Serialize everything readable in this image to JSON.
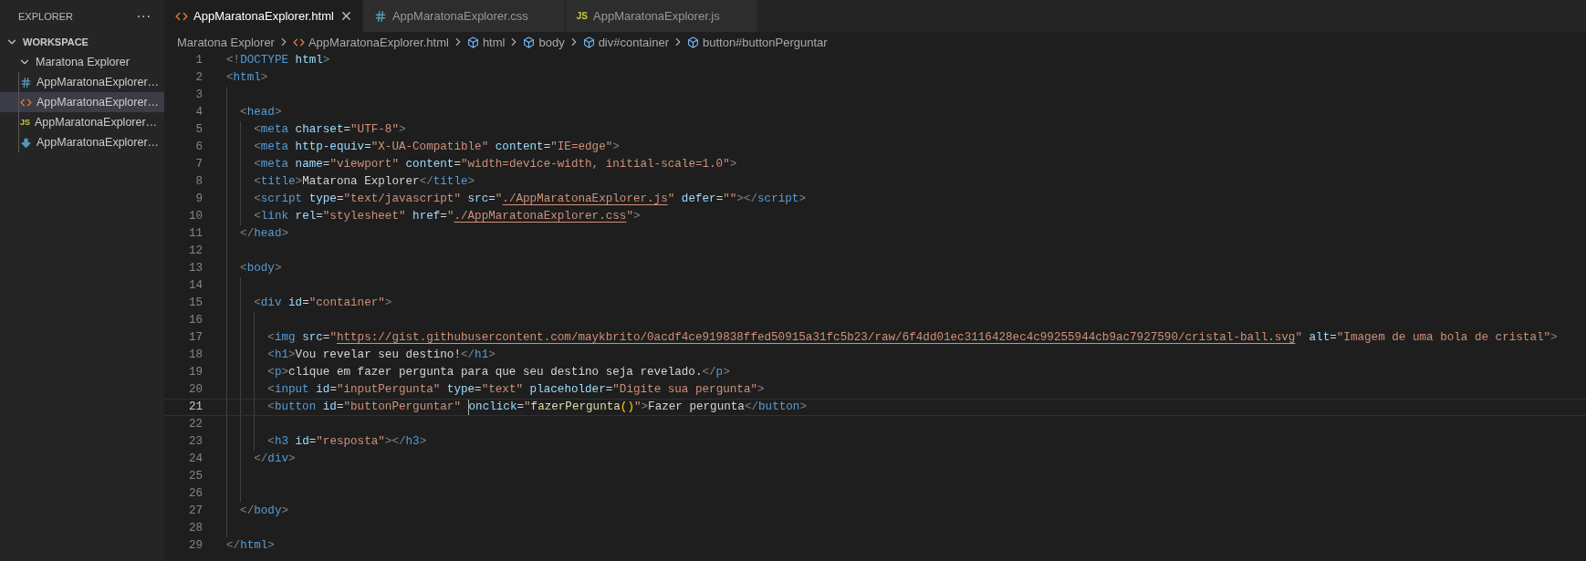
{
  "sidebar": {
    "title": "EXPLORER",
    "more": "···",
    "tree": [
      {
        "label": "WORKSPACE",
        "kind": "root",
        "expanded": true,
        "children": [
          {
            "label": "Maratona Explorer",
            "kind": "folder",
            "expanded": true,
            "children": [
              {
                "label": "AppMaratonaExplorer…",
                "kind": "css",
                "selected": false
              },
              {
                "label": "AppMaratonaExplorer…",
                "kind": "html",
                "selected": true
              },
              {
                "label": "AppMaratonaExplorer…",
                "kind": "js",
                "icon_text": "JS",
                "selected": false
              },
              {
                "label": "AppMaratonaExplorer…",
                "kind": "download",
                "selected": false
              }
            ]
          }
        ]
      }
    ]
  },
  "tabs": [
    {
      "label": "AppMaratonaExplorer.html",
      "kind": "html",
      "selected": true
    },
    {
      "label": "AppMaratonaExplorer.css",
      "kind": "css",
      "selected": false
    },
    {
      "label": "AppMaratonaExplorer.js",
      "kind": "js",
      "icon_text": "JS",
      "selected": false
    }
  ],
  "breadcrumbs": [
    {
      "label": "Maratona Explorer",
      "kind": "folder"
    },
    {
      "label": "AppMaratonaExplorer.html",
      "kind": "html"
    },
    {
      "label": "html",
      "kind": "element"
    },
    {
      "label": "body",
      "kind": "element"
    },
    {
      "label": "div#container",
      "kind": "element"
    },
    {
      "label": "button#buttonPerguntar",
      "kind": "element"
    }
  ],
  "editor": {
    "lines": [
      {
        "number": "1",
        "current": false,
        "tokens": [
          {
            "kind": "punct",
            "text": "<!"
          },
          {
            "kind": "tag",
            "text": "DOCTYPE"
          },
          {
            "kind": "attr",
            "text": " html"
          },
          {
            "kind": "punct",
            "text": ">"
          }
        ]
      },
      {
        "number": "2",
        "current": false,
        "tokens": [
          {
            "kind": "punct",
            "text": "<"
          },
          {
            "kind": "tag",
            "text": "html"
          },
          {
            "kind": "punct",
            "text": ">"
          }
        ]
      },
      {
        "number": "3",
        "current": false
      },
      {
        "number": "4",
        "current": false,
        "tokens": [
          {
            "kind": "punct",
            "text": "  <"
          },
          {
            "kind": "tag",
            "text": "head"
          },
          {
            "kind": "punct",
            "text": ">"
          }
        ]
      },
      {
        "number": "5",
        "current": false,
        "tokens": [
          {
            "kind": "punct",
            "text": "    <"
          },
          {
            "kind": "tag",
            "text": "meta"
          },
          {
            "kind": "attr",
            "text": " charset"
          },
          {
            "kind": "text",
            "text": "="
          },
          {
            "kind": "string",
            "text": "\"UTF-8\""
          },
          {
            "kind": "punct",
            "text": ">"
          }
        ]
      },
      {
        "number": "6",
        "current": false,
        "tokens": [
          {
            "kind": "punct",
            "text": "    <"
          },
          {
            "kind": "tag",
            "text": "meta"
          },
          {
            "kind": "attr",
            "text": " http-equiv"
          },
          {
            "kind": "text",
            "text": "="
          },
          {
            "kind": "string",
            "text": "\"X-UA-Compatible\""
          },
          {
            "kind": "attr",
            "text": " content"
          },
          {
            "kind": "text",
            "text": "="
          },
          {
            "kind": "string",
            "text": "\"IE=edge\""
          },
          {
            "kind": "punct",
            "text": ">"
          }
        ]
      },
      {
        "number": "7",
        "current": false,
        "tokens": [
          {
            "kind": "punct",
            "text": "    <"
          },
          {
            "kind": "tag",
            "text": "meta"
          },
          {
            "kind": "attr",
            "text": " name"
          },
          {
            "kind": "text",
            "text": "="
          },
          {
            "kind": "string",
            "text": "\"viewport\""
          },
          {
            "kind": "attr",
            "text": " content"
          },
          {
            "kind": "text",
            "text": "="
          },
          {
            "kind": "string",
            "text": "\"width=device-width, initial-scale=1.0\""
          },
          {
            "kind": "punct",
            "text": ">"
          }
        ]
      },
      {
        "number": "8",
        "current": false,
        "tokens": [
          {
            "kind": "punct",
            "text": "    <"
          },
          {
            "kind": "tag",
            "text": "title"
          },
          {
            "kind": "punct",
            "text": ">"
          },
          {
            "kind": "text",
            "text": "Matarona Explorer"
          },
          {
            "kind": "punct",
            "text": "</"
          },
          {
            "kind": "tag",
            "text": "title"
          },
          {
            "kind": "punct",
            "text": ">"
          }
        ]
      },
      {
        "number": "9",
        "current": false,
        "tokens": [
          {
            "kind": "punct",
            "text": "    <"
          },
          {
            "kind": "tag",
            "text": "script"
          },
          {
            "kind": "attr",
            "text": " type"
          },
          {
            "kind": "text",
            "text": "="
          },
          {
            "kind": "string",
            "text": "\"text/javascript\""
          },
          {
            "kind": "attr",
            "text": " src"
          },
          {
            "kind": "text",
            "text": "="
          },
          {
            "kind": "string",
            "text": "\""
          },
          {
            "kind": "link",
            "text": "./AppMaratonaExplorer.js"
          },
          {
            "kind": "string",
            "text": "\""
          },
          {
            "kind": "attr",
            "text": " defer"
          },
          {
            "kind": "text",
            "text": "="
          },
          {
            "kind": "string",
            "text": "\"\""
          },
          {
            "kind": "punct",
            "text": "></"
          },
          {
            "kind": "tag",
            "text": "script"
          },
          {
            "kind": "punct",
            "text": ">"
          }
        ]
      },
      {
        "number": "10",
        "current": false,
        "tokens": [
          {
            "kind": "punct",
            "text": "    <"
          },
          {
            "kind": "tag",
            "text": "link"
          },
          {
            "kind": "attr",
            "text": " rel"
          },
          {
            "kind": "text",
            "text": "="
          },
          {
            "kind": "string",
            "text": "\"stylesheet\""
          },
          {
            "kind": "attr",
            "text": " href"
          },
          {
            "kind": "text",
            "text": "="
          },
          {
            "kind": "string",
            "text": "\""
          },
          {
            "kind": "link",
            "text": "./AppMaratonaExplorer.css"
          },
          {
            "kind": "string",
            "text": "\""
          },
          {
            "kind": "punct",
            "text": ">"
          }
        ]
      },
      {
        "number": "11",
        "current": false,
        "tokens": [
          {
            "kind": "punct",
            "text": "  </"
          },
          {
            "kind": "tag",
            "text": "head"
          },
          {
            "kind": "punct",
            "text": ">"
          }
        ]
      },
      {
        "number": "12",
        "current": false
      },
      {
        "number": "13",
        "current": false,
        "tokens": [
          {
            "kind": "punct",
            "text": "  <"
          },
          {
            "kind": "tag",
            "text": "body"
          },
          {
            "kind": "punct",
            "text": ">"
          }
        ]
      },
      {
        "number": "14",
        "current": false
      },
      {
        "number": "15",
        "current": false,
        "tokens": [
          {
            "kind": "punct",
            "text": "    <"
          },
          {
            "kind": "tag",
            "text": "div"
          },
          {
            "kind": "attr",
            "text": " id"
          },
          {
            "kind": "text",
            "text": "="
          },
          {
            "kind": "string",
            "text": "\"container\""
          },
          {
            "kind": "punct",
            "text": ">"
          }
        ]
      },
      {
        "number": "16",
        "current": false
      },
      {
        "number": "17",
        "current": false,
        "tokens": [
          {
            "kind": "punct",
            "text": "      <"
          },
          {
            "kind": "tag",
            "text": "img"
          },
          {
            "kind": "attr",
            "text": " src"
          },
          {
            "kind": "text",
            "text": "="
          },
          {
            "kind": "string",
            "text": "\""
          },
          {
            "kind": "link",
            "text": "https://gist.githubusercontent.com/maykbrito/0acdf4ce919838ffed50915a31fc5b23/raw/6f4dd01ec3116428ec4c99255944cb9ac7927590/cristal-ball.svg"
          },
          {
            "kind": "string",
            "text": "\""
          },
          {
            "kind": "attr",
            "text": " alt"
          },
          {
            "kind": "text",
            "text": "="
          },
          {
            "kind": "string",
            "text": "\"Imagem de uma bola de cristal\""
          },
          {
            "kind": "punct",
            "text": ">"
          }
        ]
      },
      {
        "number": "18",
        "current": false,
        "tokens": [
          {
            "kind": "punct",
            "text": "      <"
          },
          {
            "kind": "tag",
            "text": "h1"
          },
          {
            "kind": "punct",
            "text": ">"
          },
          {
            "kind": "text",
            "text": "Vou revelar seu destino!"
          },
          {
            "kind": "punct",
            "text": "</"
          },
          {
            "kind": "tag",
            "text": "h1"
          },
          {
            "kind": "punct",
            "text": ">"
          }
        ]
      },
      {
        "number": "19",
        "current": false,
        "tokens": [
          {
            "kind": "punct",
            "text": "      <"
          },
          {
            "kind": "tag",
            "text": "p"
          },
          {
            "kind": "punct",
            "text": ">"
          },
          {
            "kind": "text",
            "text": "clique em fazer pergunta para que seu destino seja revelado."
          },
          {
            "kind": "punct",
            "text": "</"
          },
          {
            "kind": "tag",
            "text": "p"
          },
          {
            "kind": "punct",
            "text": ">"
          }
        ]
      },
      {
        "number": "20",
        "current": false,
        "tokens": [
          {
            "kind": "punct",
            "text": "      <"
          },
          {
            "kind": "tag",
            "text": "input"
          },
          {
            "kind": "attr",
            "text": " id"
          },
          {
            "kind": "text",
            "text": "="
          },
          {
            "kind": "string",
            "text": "\"inputPergunta\""
          },
          {
            "kind": "attr",
            "text": " type"
          },
          {
            "kind": "text",
            "text": "="
          },
          {
            "kind": "string",
            "text": "\"text\""
          },
          {
            "kind": "attr",
            "text": " placeholder"
          },
          {
            "kind": "text",
            "text": "="
          },
          {
            "kind": "string",
            "text": "\"Digite sua pergunta\""
          },
          {
            "kind": "punct",
            "text": ">"
          }
        ]
      },
      {
        "number": "21",
        "current": true,
        "tokens": [
          {
            "kind": "punct",
            "text": "      <"
          },
          {
            "kind": "tag",
            "text": "button"
          },
          {
            "kind": "attr",
            "text": " id"
          },
          {
            "kind": "text",
            "text": "="
          },
          {
            "kind": "string",
            "text": "\"buttonPerguntar\" "
          },
          {
            "kind": "cursor"
          },
          {
            "kind": "attr",
            "text": "onclick"
          },
          {
            "kind": "text",
            "text": "="
          },
          {
            "kind": "string",
            "text": "\""
          },
          {
            "kind": "function",
            "text": "fazerPergunta"
          },
          {
            "kind": "paren",
            "text": "()"
          },
          {
            "kind": "string",
            "text": "\""
          },
          {
            "kind": "punct",
            "text": ">"
          },
          {
            "kind": "text",
            "text": "Fazer pergunta"
          },
          {
            "kind": "punct",
            "text": "</"
          },
          {
            "kind": "tag",
            "text": "button"
          },
          {
            "kind": "punct",
            "text": ">"
          }
        ]
      },
      {
        "number": "22",
        "current": false
      },
      {
        "number": "23",
        "current": false,
        "tokens": [
          {
            "kind": "punct",
            "text": "      <"
          },
          {
            "kind": "tag",
            "text": "h3"
          },
          {
            "kind": "attr",
            "text": " id"
          },
          {
            "kind": "text",
            "text": "="
          },
          {
            "kind": "string",
            "text": "\"resposta\""
          },
          {
            "kind": "punct",
            "text": "></"
          },
          {
            "kind": "tag",
            "text": "h3"
          },
          {
            "kind": "punct",
            "text": ">"
          }
        ]
      },
      {
        "number": "24",
        "current": false,
        "tokens": [
          {
            "kind": "punct",
            "text": "    </"
          },
          {
            "kind": "tag",
            "text": "div"
          },
          {
            "kind": "punct",
            "text": ">"
          }
        ]
      },
      {
        "number": "25",
        "current": false
      },
      {
        "number": "26",
        "current": false
      },
      {
        "number": "27",
        "current": false,
        "tokens": [
          {
            "kind": "punct",
            "text": "  </"
          },
          {
            "kind": "tag",
            "text": "body"
          },
          {
            "kind": "punct",
            "text": ">"
          }
        ]
      },
      {
        "number": "28",
        "current": false
      },
      {
        "number": "29",
        "current": false,
        "tokens": [
          {
            "kind": "punct",
            "text": "</"
          },
          {
            "kind": "tag",
            "text": "html"
          },
          {
            "kind": "punct",
            "text": ">"
          }
        ]
      }
    ]
  }
}
